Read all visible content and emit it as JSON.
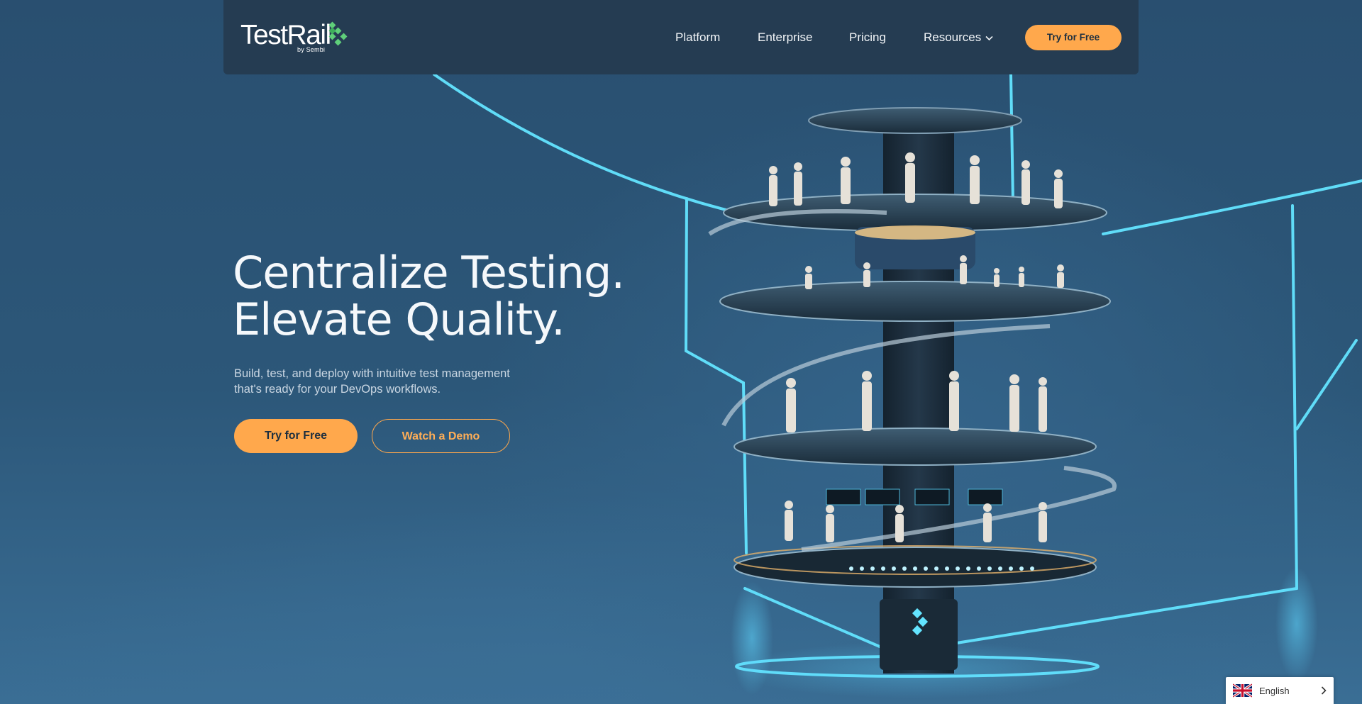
{
  "brand": {
    "name": "TestRail",
    "byline": "by Sembi",
    "accent_color": "#ffa84c",
    "logo_mark_color": "#5fcf7a"
  },
  "nav": {
    "links": [
      "Platform",
      "Enterprise",
      "Pricing",
      "Resources"
    ],
    "cta_label": "Try for Free"
  },
  "hero": {
    "title_line1": "Centralize Testing.",
    "title_line2": "Elevate Quality.",
    "subtitle_line1": "Build, test, and deploy with intuitive test management",
    "subtitle_line2": "that's ready for your DevOps workflows.",
    "primary_label": "Try for Free",
    "secondary_label": "Watch a Demo"
  },
  "language": {
    "selected": "English",
    "flag_icon": "uk-flag-icon"
  }
}
